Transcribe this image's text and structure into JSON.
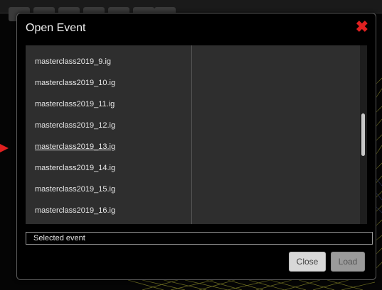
{
  "dialog": {
    "title": "Open Event",
    "close_icon": "close-x-icon"
  },
  "file_list": {
    "items": [
      {
        "label": "masterclass2019_9.ig",
        "selected": false
      },
      {
        "label": "masterclass2019_10.ig",
        "selected": false
      },
      {
        "label": "masterclass2019_11.ig",
        "selected": false
      },
      {
        "label": "masterclass2019_12.ig",
        "selected": false
      },
      {
        "label": "masterclass2019_13.ig",
        "selected": true
      },
      {
        "label": "masterclass2019_14.ig",
        "selected": false
      },
      {
        "label": "masterclass2019_15.ig",
        "selected": false
      },
      {
        "label": "masterclass2019_16.ig",
        "selected": false
      }
    ]
  },
  "selected_event": {
    "value": "Selected event"
  },
  "buttons": {
    "close_label": "Close",
    "load_label": "Load"
  },
  "colors": {
    "close_icon": "#e02020",
    "pointer_arrow": "#e02020"
  }
}
